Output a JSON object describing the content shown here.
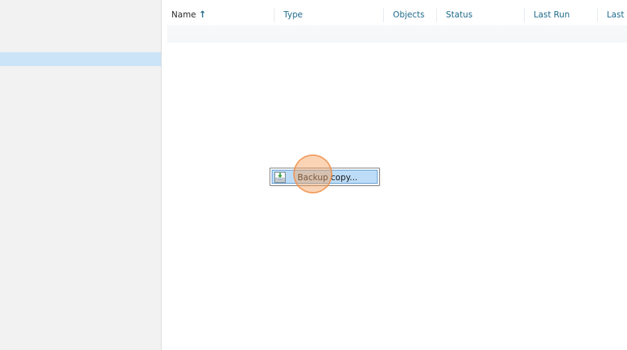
{
  "columns": {
    "name": "Name",
    "sort_arrow": "↑",
    "type": "Type",
    "objects": "Objects",
    "status": "Status",
    "last_run": "Last Run",
    "last_result": "Last R"
  },
  "context_menu": {
    "items": [
      {
        "label": "Backup copy...",
        "icon": "backup-copy-icon"
      }
    ]
  },
  "colors": {
    "header_text": "#1f6a8a",
    "selection": "#cce4f7",
    "menu_highlight": "#bcdcf7",
    "click_indicator": "#f5a05a"
  }
}
